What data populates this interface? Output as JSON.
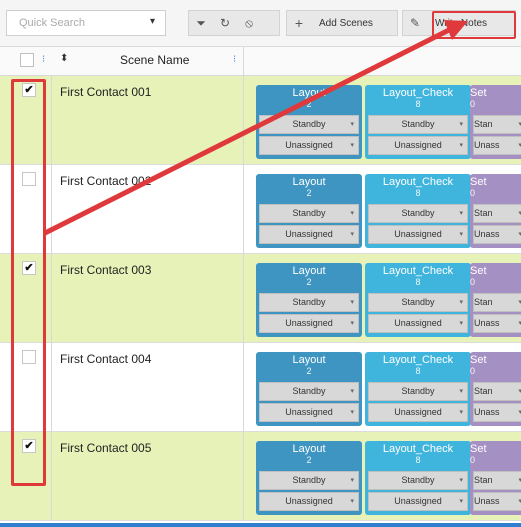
{
  "toolbar": {
    "search_placeholder": "Quick Search",
    "search_chevron": "▾",
    "filter_icon": "⏷",
    "refresh_icon": "↻",
    "clear_icon": "⦸",
    "add_icon": "+",
    "add_scenes_label": "Add Scenes",
    "notes_icon": "✎",
    "write_notes_label": "Write Notes"
  },
  "header": {
    "sort_icon": "⬍",
    "column_dots": "⁝",
    "scene_name_label": "Scene Name"
  },
  "rows": [
    {
      "name": "First Contact 001",
      "checked": true,
      "check_mark": "✔"
    },
    {
      "name": "First Contact 002",
      "checked": false,
      "check_mark": ""
    },
    {
      "name": "First Contact 003",
      "checked": true,
      "check_mark": "✔"
    },
    {
      "name": "First Contact 004",
      "checked": false,
      "check_mark": ""
    },
    {
      "name": "First Contact 005",
      "checked": true,
      "check_mark": "✔"
    }
  ],
  "tasks": {
    "layout": {
      "title": "Layout",
      "count": "2",
      "color": "#3e95c2"
    },
    "layout_check": {
      "title": "Layout_Check",
      "count": "8",
      "color": "#3fb4dc"
    },
    "setup": {
      "title": "Set",
      "count": "0",
      "color": "#a590c4"
    }
  },
  "status_value": "Standby",
  "assignee_value": "Unassigned",
  "setup_status_value": "Stan",
  "setup_assignee_value": "Unass",
  "dropdown_arrow": "▾",
  "annotation_color": "#e0393b"
}
